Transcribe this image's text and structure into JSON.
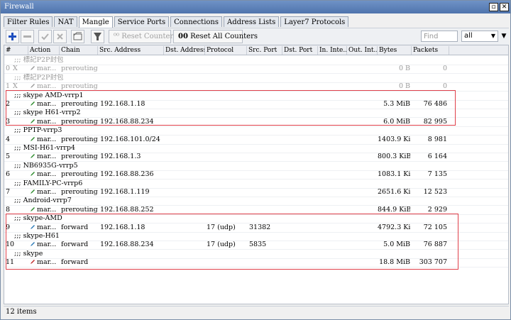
{
  "window": {
    "title": "Firewall"
  },
  "tabs": [
    {
      "label": "Filter Rules",
      "active": false
    },
    {
      "label": "NAT",
      "active": false
    },
    {
      "label": "Mangle",
      "active": true
    },
    {
      "label": "Service Ports",
      "active": false
    },
    {
      "label": "Connections",
      "active": false
    },
    {
      "label": "Address Lists",
      "active": false
    },
    {
      "label": "Layer7 Protocols",
      "active": false
    }
  ],
  "toolbar": {
    "add_icon": "plus-icon",
    "remove_icon": "minus-icon",
    "enable_icon": "check-icon",
    "disable_icon": "x-icon",
    "comment_icon": "note-icon",
    "filter_icon": "funnel-icon",
    "reset_counters_label": "Reset Counters",
    "reset_all_counters_label": "Reset All Counters",
    "reset_all_prefix": "00",
    "find_placeholder": "Find",
    "filter_value": "all"
  },
  "columns": [
    "#",
    "Action",
    "Chain",
    "Src. Address",
    "Dst. Address",
    "Protocol",
    "Src. Port",
    "Dst. Port",
    "In. Inte...",
    "Out. Int...",
    "Bytes",
    "Packets"
  ],
  "rows": [
    {
      "type": "comment",
      "text": ";;; 標記P2P封包",
      "disabled": true
    },
    {
      "type": "rule",
      "num": "0",
      "flag": "X",
      "action": "mar...",
      "chain": "prerouting",
      "src": "",
      "protocol": "",
      "sport": "",
      "bytes": "0 B",
      "packets": "0",
      "disabled": true,
      "icon_color": "#9a9a9a"
    },
    {
      "type": "comment",
      "text": ";;; 標記P2P封包",
      "disabled": true
    },
    {
      "type": "rule",
      "num": "1",
      "flag": "X",
      "action": "mar...",
      "chain": "prerouting",
      "src": "",
      "protocol": "",
      "sport": "",
      "bytes": "0 B",
      "packets": "0",
      "disabled": true,
      "icon_color": "#9a9a9a"
    },
    {
      "type": "comment",
      "text": ";;; skype AMD-vrrp1",
      "disabled": false
    },
    {
      "type": "rule",
      "num": "2",
      "flag": "",
      "action": "mar...",
      "chain": "prerouting",
      "src": "192.168.1.18",
      "protocol": "",
      "sport": "",
      "bytes": "5.3 MiB",
      "packets": "76 486",
      "disabled": false,
      "icon_color": "#2a8a2a"
    },
    {
      "type": "comment",
      "text": ";;; skype H61-vrrp2",
      "disabled": false
    },
    {
      "type": "rule",
      "num": "3",
      "flag": "",
      "action": "mar...",
      "chain": "prerouting",
      "src": "192.168.88.234",
      "protocol": "",
      "sport": "",
      "bytes": "6.0 MiB",
      "packets": "82 995",
      "disabled": false,
      "icon_color": "#2a8a2a"
    },
    {
      "type": "comment",
      "text": ";;; PPTP-vrrp3",
      "disabled": false
    },
    {
      "type": "rule",
      "num": "4",
      "flag": "",
      "action": "mar...",
      "chain": "prerouting",
      "src": "192.168.101.0/24",
      "protocol": "",
      "sport": "",
      "bytes": "1403.9 KiB",
      "packets": "8 981",
      "disabled": false,
      "icon_color": "#2a8a2a"
    },
    {
      "type": "comment",
      "text": ";;; MSI-H61-vrrp4",
      "disabled": false
    },
    {
      "type": "rule",
      "num": "5",
      "flag": "",
      "action": "mar...",
      "chain": "prerouting",
      "src": "192.168.1.3",
      "protocol": "",
      "sport": "",
      "bytes": "800.3 KiB",
      "packets": "6 164",
      "disabled": false,
      "icon_color": "#2a8a2a"
    },
    {
      "type": "comment",
      "text": ";;; NB6935G-vrrp5",
      "disabled": false
    },
    {
      "type": "rule",
      "num": "6",
      "flag": "",
      "action": "mar...",
      "chain": "prerouting",
      "src": "192.168.88.236",
      "protocol": "",
      "sport": "",
      "bytes": "1083.1 KiB",
      "packets": "7 135",
      "disabled": false,
      "icon_color": "#2a8a2a"
    },
    {
      "type": "comment",
      "text": ";;; FAMILY-PC-vrrp6",
      "disabled": false
    },
    {
      "type": "rule",
      "num": "7",
      "flag": "",
      "action": "mar...",
      "chain": "prerouting",
      "src": "192.168.1.119",
      "protocol": "",
      "sport": "",
      "bytes": "2651.6 KiB",
      "packets": "12 523",
      "disabled": false,
      "icon_color": "#2a8a2a"
    },
    {
      "type": "comment",
      "text": ";;; Android-vrrp7",
      "disabled": false
    },
    {
      "type": "rule",
      "num": "8",
      "flag": "",
      "action": "mar...",
      "chain": "prerouting",
      "src": "192.168.88.252",
      "protocol": "",
      "sport": "",
      "bytes": "844.9 KiB",
      "packets": "2 929",
      "disabled": false,
      "icon_color": "#2a8a2a"
    },
    {
      "type": "comment",
      "text": ";;; skype-AMD",
      "disabled": false
    },
    {
      "type": "rule",
      "num": "9",
      "flag": "",
      "action": "mar...",
      "chain": "forward",
      "src": "192.168.1.18",
      "protocol": "17 (udp)",
      "sport": "31382",
      "bytes": "4792.3 KiB",
      "packets": "72 105",
      "disabled": false,
      "icon_color": "#2a7ab8"
    },
    {
      "type": "comment",
      "text": ";;; skype-H61",
      "disabled": false
    },
    {
      "type": "rule",
      "num": "10",
      "flag": "",
      "action": "mar...",
      "chain": "forward",
      "src": "192.168.88.234",
      "protocol": "17 (udp)",
      "sport": "5835",
      "bytes": "5.0 MiB",
      "packets": "76 887",
      "disabled": false,
      "icon_color": "#2a7ab8"
    },
    {
      "type": "comment",
      "text": ";;; skype",
      "disabled": false
    },
    {
      "type": "rule",
      "num": "11",
      "flag": "",
      "action": "mar...",
      "chain": "forward",
      "src": "",
      "protocol": "",
      "sport": "",
      "bytes": "18.8 MiB",
      "packets": "303 707",
      "disabled": false,
      "icon_color": "#c02828"
    }
  ],
  "status": {
    "items_text": "12 items"
  },
  "colors": {
    "highlight_box": "#e0404a",
    "titlebar": "#5b7fb8"
  }
}
